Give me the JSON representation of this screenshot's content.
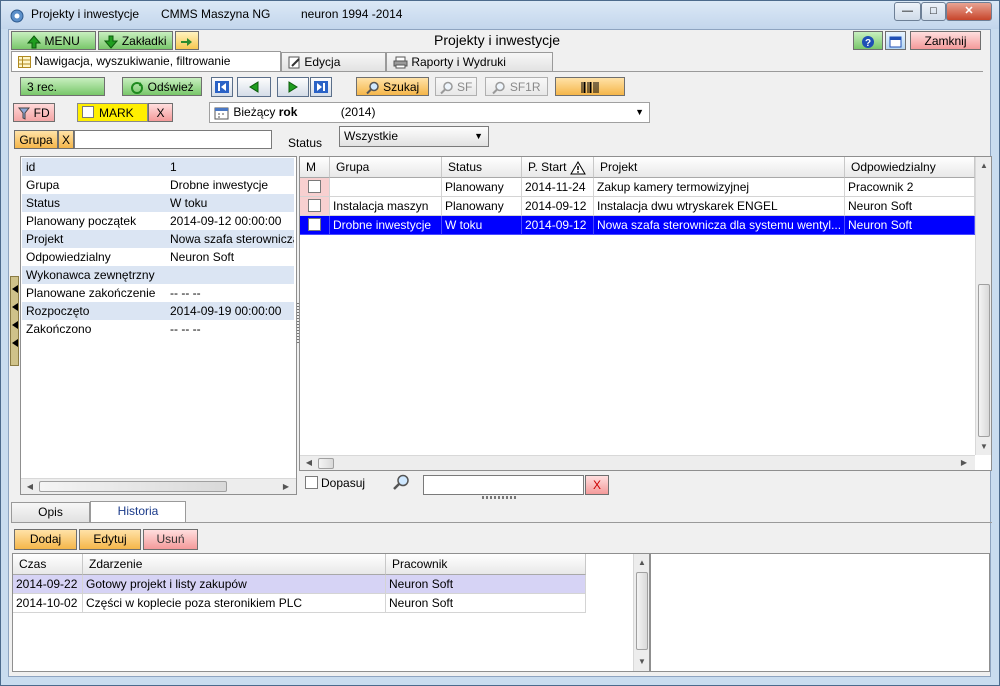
{
  "window": {
    "title": "Projekty i inwestycje",
    "app_name": "CMMS Maszyna NG",
    "company": "neuron 1994 -2014",
    "minimize": "—",
    "maximize": "□",
    "close": "✕"
  },
  "toolbar": {
    "menu_label": "MENU",
    "bookmarks_label": "Zakładki",
    "heading": "Projekty i inwestycje",
    "help_label": "?",
    "close_label": "Zamknij"
  },
  "tabs": [
    {
      "label": "Nawigacja, wyszukiwanie, filtrowanie"
    },
    {
      "label": "Edycja"
    },
    {
      "label": "Raporty i Wydruki"
    }
  ],
  "nav": {
    "record_count": "3 rec.",
    "refresh_label": "Odśwież",
    "search_label": "Szukaj",
    "sf_label": "SF",
    "sf1r_label": "SF1R"
  },
  "filter": {
    "fd_label": "FD",
    "mark_label": "MARK",
    "mark_clear": "X",
    "period_prefix": "Bieżący",
    "period_bold": "rok",
    "period_value": "(2014)",
    "group_label": "Grupa",
    "group_clear": "X",
    "group_value": "",
    "status_label": "Status",
    "status_value": "Wszystkie"
  },
  "details": [
    {
      "key": "id",
      "value": "1"
    },
    {
      "key": "Grupa",
      "value": "Drobne inwestycje"
    },
    {
      "key": "Status",
      "value": "W toku"
    },
    {
      "key": "Planowany początek",
      "value": "2014-09-12  00:00:00"
    },
    {
      "key": "Projekt",
      "value": "Nowa szafa sterownicza"
    },
    {
      "key": "Odpowiedzialny",
      "value": "Neuron Soft"
    },
    {
      "key": "Wykonawca zewnętrzny",
      "value": ""
    },
    {
      "key": "Planowane zakończenie",
      "value": "-- --  --"
    },
    {
      "key": "Rozpoczęto",
      "value": "2014-09-19  00:00:00"
    },
    {
      "key": "Zakończono",
      "value": "-- --  --"
    }
  ],
  "grid": {
    "columns": [
      "M",
      "Grupa",
      "Status",
      "P. Start",
      "Projekt",
      "Odpowiedzialny"
    ],
    "rows": [
      {
        "grupa": "",
        "status": "Planowany",
        "start": "2014-11-24",
        "projekt": "Zakup kamery termowizyjnej",
        "odp": "Pracownik 2"
      },
      {
        "grupa": "Instalacja maszyn",
        "status": "Planowany",
        "start": "2014-09-12",
        "projekt": "Instalacja dwu wtryskarek ENGEL",
        "odp": "Neuron Soft"
      },
      {
        "grupa": "Drobne inwestycje",
        "status": "W toku",
        "start": "2014-09-12",
        "projekt": "Nowa szafa sterownicza dla systemu wentyl...",
        "odp": "Neuron Soft"
      }
    ],
    "fit_label": "Dopasuj",
    "search_value": "",
    "search_clear": "X"
  },
  "bottom_tabs": [
    {
      "label": "Opis"
    },
    {
      "label": "Historia"
    }
  ],
  "history": {
    "add_label": "Dodaj",
    "edit_label": "Edytuj",
    "delete_label": "Usuń",
    "columns": [
      "Czas",
      "Zdarzenie",
      "Pracownik"
    ],
    "rows": [
      {
        "time": "2014-09-22",
        "event": "Gotowy projekt i listy zakupów",
        "worker": "Neuron Soft"
      },
      {
        "time": "2014-10-02",
        "event": "Części w koplecie poza steronikiem PLC",
        "worker": "Neuron Soft"
      }
    ]
  },
  "colors": {
    "selection": "#0000ff",
    "history_selected": "#d6d3f5",
    "detail_alt_row": "#dbe5f3"
  }
}
